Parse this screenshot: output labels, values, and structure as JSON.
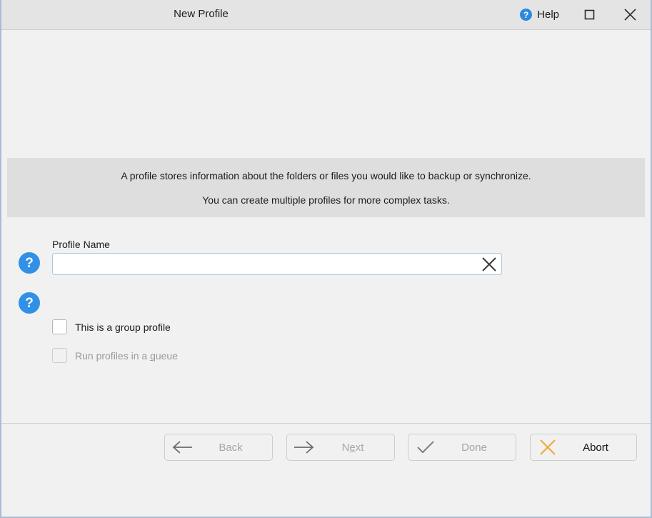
{
  "titlebar": {
    "title": "New Profile",
    "help_label": "Help",
    "help_icon": "question-circle-icon",
    "maximize_icon": "maximize-square-icon",
    "close_icon": "close-x-icon"
  },
  "info": {
    "line1": "A profile stores information about the folders or files you would like to backup or synchronize.",
    "line2": "You can create multiple profiles for more complex tasks."
  },
  "form": {
    "help_icon": "question-circle-icon",
    "profile_name_label": "Profile Name",
    "profile_name_value": "",
    "profile_name_placeholder": "",
    "clear_icon": "clear-x-icon",
    "group_profile_label": "This is a group profile",
    "group_profile_checked": false,
    "queue_label_pre": "Run profiles in a ",
    "queue_label_accel": "q",
    "queue_label_post": "ueue",
    "queue_checked": false,
    "queue_disabled": true
  },
  "footer": {
    "back": {
      "label": "Back",
      "icon": "arrow-left-icon",
      "disabled": true
    },
    "next": {
      "label_pre": "N",
      "label_accel": "e",
      "label_post": "xt",
      "icon": "arrow-right-icon",
      "disabled": true
    },
    "done": {
      "label": "Done",
      "icon": "check-icon",
      "disabled": true
    },
    "abort": {
      "label": "Abort",
      "icon": "close-x-icon",
      "disabled": false
    }
  },
  "colors": {
    "accent_blue": "#3191e6",
    "abort_orange": "#f0a93c",
    "window_bg": "#f1f1f1",
    "banner_bg": "#dedede",
    "titlebar_bg": "#e4e4e4",
    "input_border": "#a9c6de"
  }
}
